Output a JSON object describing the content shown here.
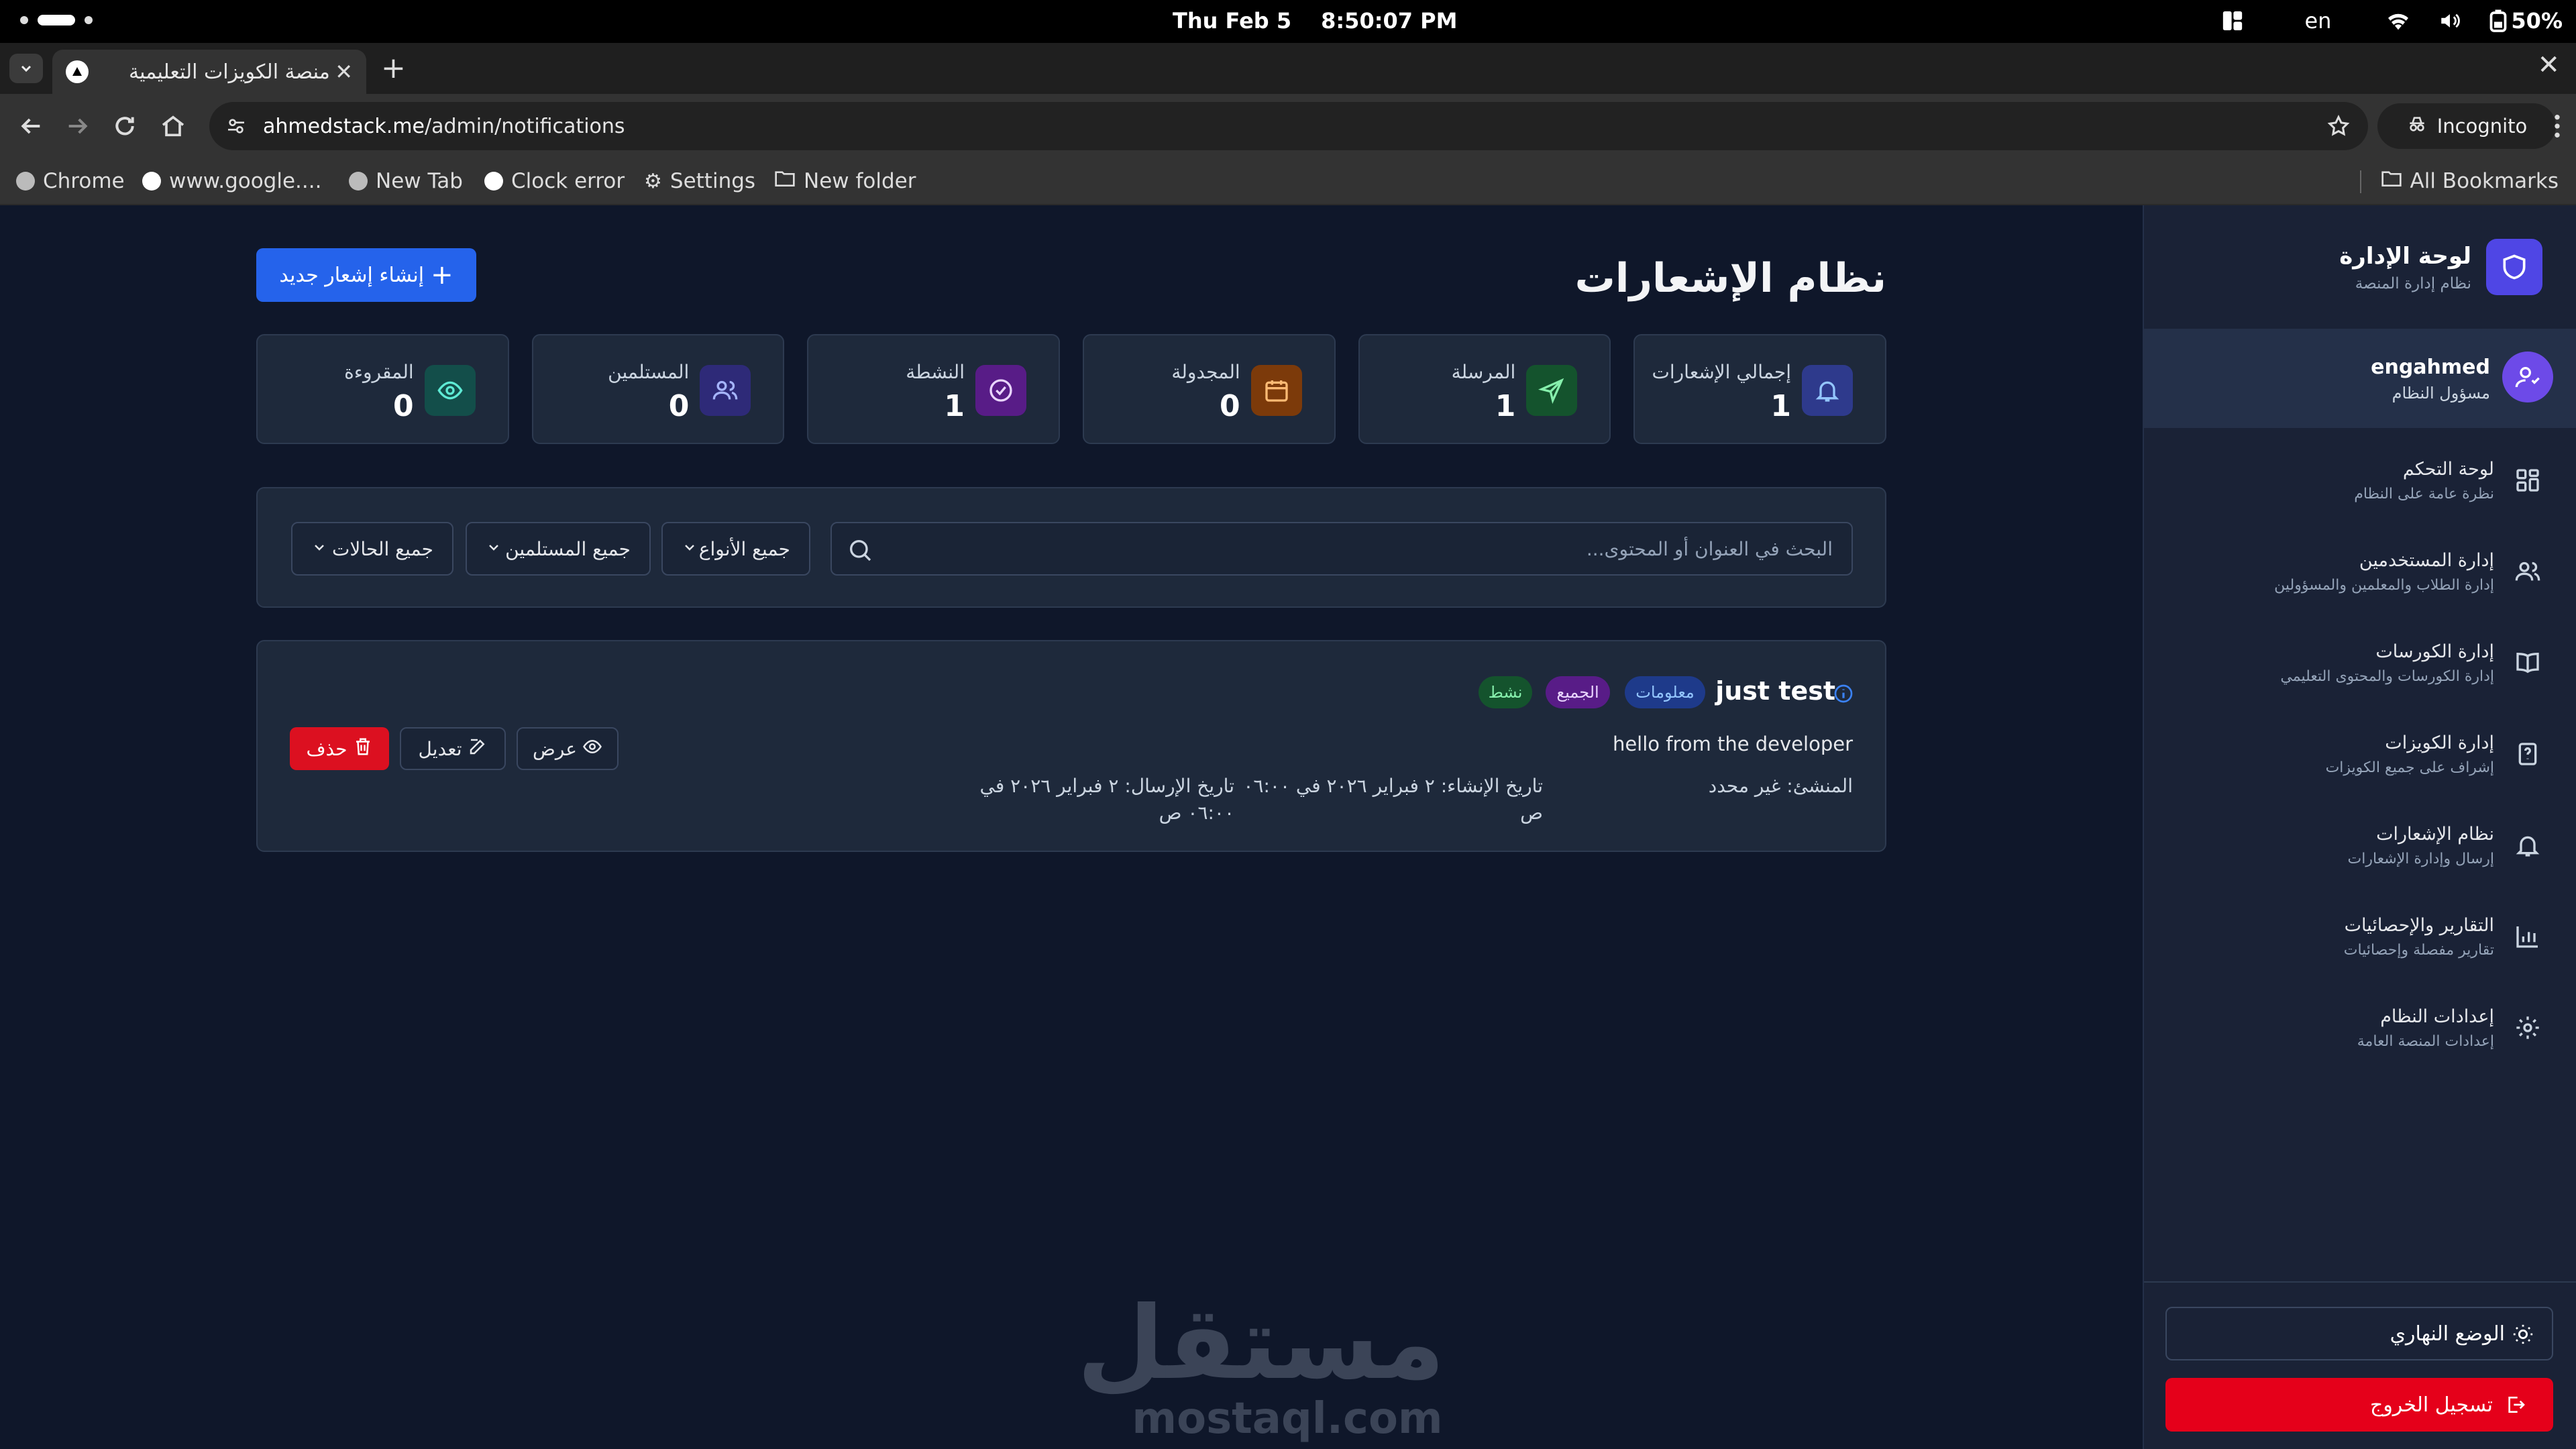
{
  "os": {
    "date": "Thu Feb 5",
    "time": "8:50:07 PM",
    "lang": "en",
    "battery": "50%"
  },
  "browser": {
    "tab_title": "منصة الكويزات التعليمية",
    "url_host": "ahmedstack.me",
    "url_path": "/admin/notifications",
    "incognito_label": "Incognito",
    "bookmarks": [
      "Chrome",
      "www.google....",
      "New Tab",
      "Clock error",
      "Settings",
      "New folder"
    ],
    "all_bookmarks": "All Bookmarks"
  },
  "page": {
    "title": "نظام الإشعارات",
    "create_button": "إنشاء إشعار جديد",
    "stats": [
      {
        "label": "إجمالي الإشعارات",
        "value": "1",
        "icon": "bell-icon",
        "color": "#3b4aa8"
      },
      {
        "label": "المرسلة",
        "value": "1",
        "icon": "send-icon",
        "color": "#166534"
      },
      {
        "label": "المجدولة",
        "value": "0",
        "icon": "calendar-icon",
        "color": "#92400e"
      },
      {
        "label": "النشطة",
        "value": "1",
        "icon": "check-circle-icon",
        "color": "#6b21a8"
      },
      {
        "label": "المستلمين",
        "value": "0",
        "icon": "users-icon",
        "color": "#312e81"
      },
      {
        "label": "المقروءة",
        "value": "0",
        "icon": "eye-icon",
        "color": "#115e59"
      }
    ],
    "filters": {
      "search_placeholder": "البحث في العنوان أو المحتوى...",
      "types": "جميع الأنواع",
      "recipients": "جميع المستلمين",
      "statuses": "جميع الحالات"
    },
    "notification": {
      "title": "just test",
      "badges": [
        "معلومات",
        "الجميع",
        "نشط"
      ],
      "body": "hello from the developer",
      "creator": "المنشئ: غير محدد",
      "created_line1": "تاريخ الإنشاء: ٢ فبراير ٢٠٢٦ في ٠٦:٠٠",
      "created_line2": "ص",
      "sent_line1": "تاريخ الإرسال: ٢ فبراير ٢٠٢٦ في",
      "sent_line2": "٠٦:٠٠ ص",
      "view": "عرض",
      "edit": "تعديل",
      "delete": "حذف"
    },
    "watermark_ar": "مستقل",
    "watermark_en": "mostaql.com"
  },
  "sidebar": {
    "brand_title": "لوحة الإدارة",
    "brand_subtitle": "نظام إدارة المنصة",
    "user_name": "engahmed",
    "user_role": "مسؤول النظام",
    "items": [
      {
        "title": "لوحة التحكم",
        "subtitle": "نظرة عامة على النظام",
        "icon": "grid-icon"
      },
      {
        "title": "إدارة المستخدمين",
        "subtitle": "إدارة الطلاب والمعلمين والمسؤولين",
        "icon": "users-icon"
      },
      {
        "title": "إدارة الكورسات",
        "subtitle": "إدارة الكورسات والمحتوى التعليمي",
        "icon": "book-icon"
      },
      {
        "title": "إدارة الكويزات",
        "subtitle": "إشراف على جميع الكويزات",
        "icon": "quiz-icon"
      },
      {
        "title": "نظام الإشعارات",
        "subtitle": "إرسال وإدارة الإشعارات",
        "icon": "bell-icon"
      },
      {
        "title": "التقارير والإحصائيات",
        "subtitle": "تقارير مفصلة وإحصائيات",
        "icon": "chart-icon"
      },
      {
        "title": "إعدادات النظام",
        "subtitle": "إعدادات المنصة العامة",
        "icon": "gear-icon"
      }
    ],
    "theme_button": "الوضع النهاري",
    "logout_button": "تسجيل الخروج"
  }
}
